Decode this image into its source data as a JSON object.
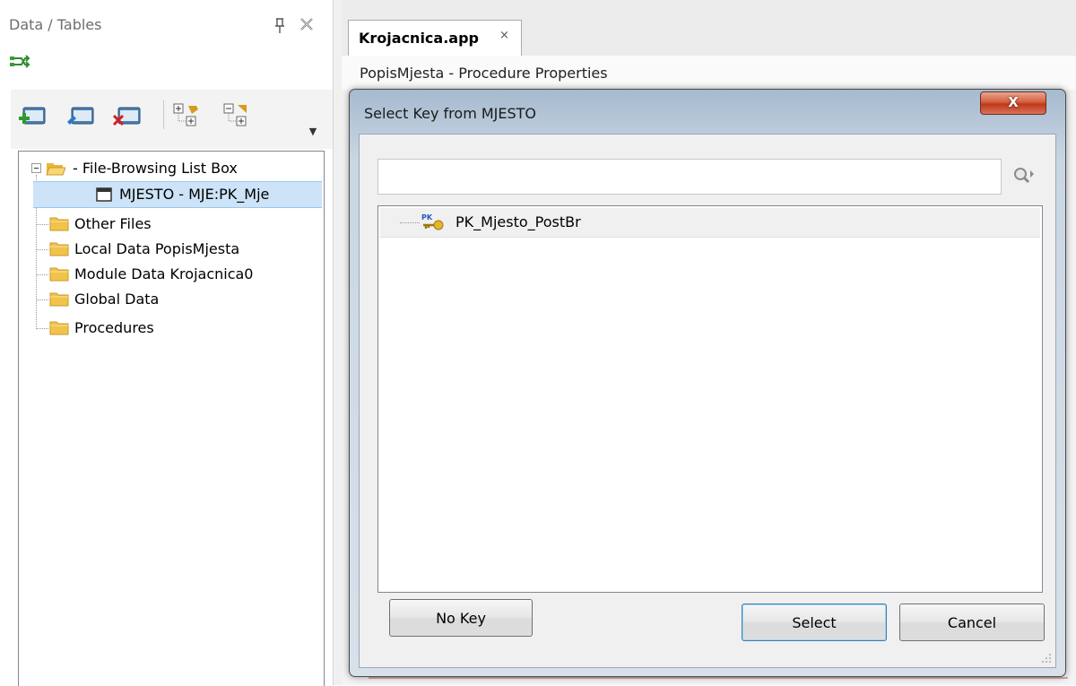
{
  "left_pane": {
    "title": "Data / Tables",
    "icons": [
      "pin-icon",
      "close-icon",
      "sync-icon",
      "insert-icon",
      "change-icon",
      "delete-icon",
      "expand-all-icon",
      "collapse-all-icon",
      "overflow-icon"
    ],
    "tree": [
      {
        "label": "- File-Browsing List Box",
        "icon": "folder-open-icon",
        "expanded": true
      },
      {
        "label": "MJESTO - MJE:PK_Mje",
        "icon": "table-icon",
        "selected": true
      },
      {
        "label": "Other Files",
        "icon": "folder-icon"
      },
      {
        "label": "Local Data PopisMjesta",
        "icon": "folder-icon"
      },
      {
        "label": "Module Data Krojacnica0",
        "icon": "folder-icon"
      },
      {
        "label": "Global Data",
        "icon": "folder-icon"
      },
      {
        "label": "Procedures",
        "icon": "folder-icon"
      }
    ]
  },
  "editor": {
    "tab_label": "Krojacnica.app",
    "tab_close": "×",
    "header": "PopisMjesta - Procedure Properties"
  },
  "dialog": {
    "title": "Select Key from MJESTO",
    "close_glyph": "X",
    "search": {
      "value": "",
      "placeholder": ""
    },
    "keys": [
      {
        "label": "PK_Mjesto_PostBr",
        "icon": "primary-key-icon"
      }
    ],
    "buttons": {
      "no_key": "No Key",
      "select": "Select",
      "cancel": "Cancel"
    }
  },
  "colors": {
    "selection": "#cde3f7",
    "dialog_frame": "#c9d6e3",
    "close_button": "#c1391a",
    "folder": "#f0c34a"
  }
}
